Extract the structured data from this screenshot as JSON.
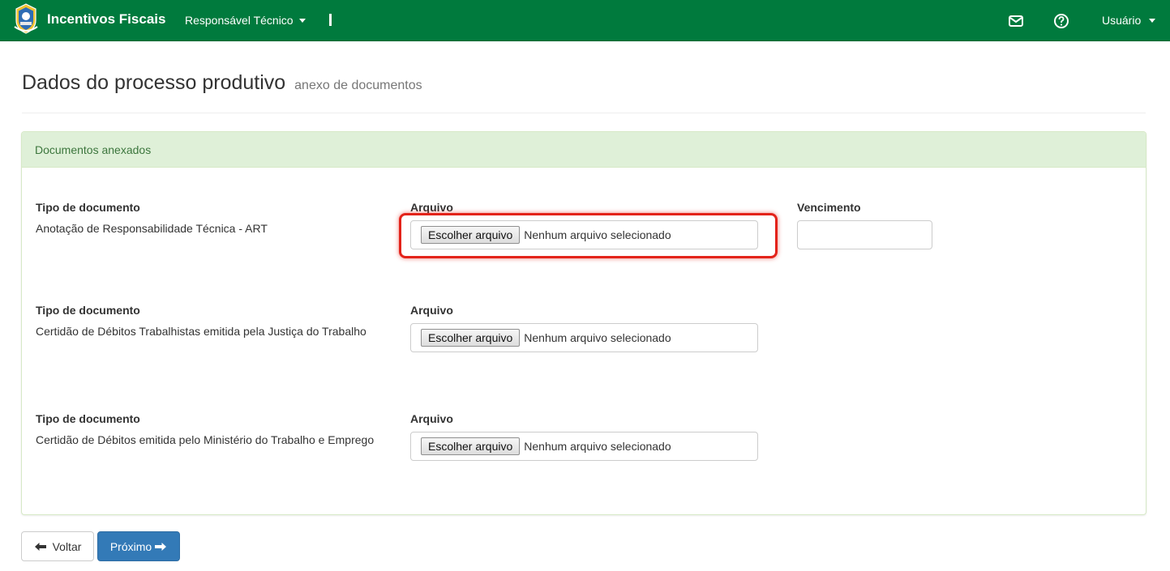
{
  "navbar": {
    "brand": "Incentivos Fiscais",
    "role_menu": "Responsável Técnico",
    "separator": "I",
    "user_menu": "Usuário",
    "bg_color": "#007a3d"
  },
  "page": {
    "title": "Dados do processo produtivo",
    "subtitle": "anexo de documentos"
  },
  "panel": {
    "heading": "Documentos anexados",
    "documents": [
      {
        "type_label": "Tipo de documento",
        "type_value": "Anotação de Responsabilidade Técnica - ART",
        "file_label": "Arquivo",
        "file_button": "Escolher arquivo",
        "file_status": "Nenhum arquivo selecionado",
        "expiry_label": "Vencimento",
        "expiry_value": ""
      },
      {
        "type_label": "Tipo de documento",
        "type_value": "Certidão de Débitos Trabalhistas emitida pela Justiça do Trabalho",
        "file_label": "Arquivo",
        "file_button": "Escolher arquivo",
        "file_status": "Nenhum arquivo selecionado"
      },
      {
        "type_label": "Tipo de documento",
        "type_value": "Certidão de Débitos emitida pelo Ministério do Trabalho e Emprego",
        "file_label": "Arquivo",
        "file_button": "Escolher arquivo",
        "file_status": "Nenhum arquivo selecionado"
      }
    ]
  },
  "actions": {
    "back": "Voltar",
    "next": "Próximo"
  },
  "icons": {
    "logo": "state-coat-of-arms-icon",
    "mail": "envelope-icon",
    "help": "question-circle-icon",
    "back": "arrow-left-icon",
    "next": "arrow-right-icon"
  }
}
